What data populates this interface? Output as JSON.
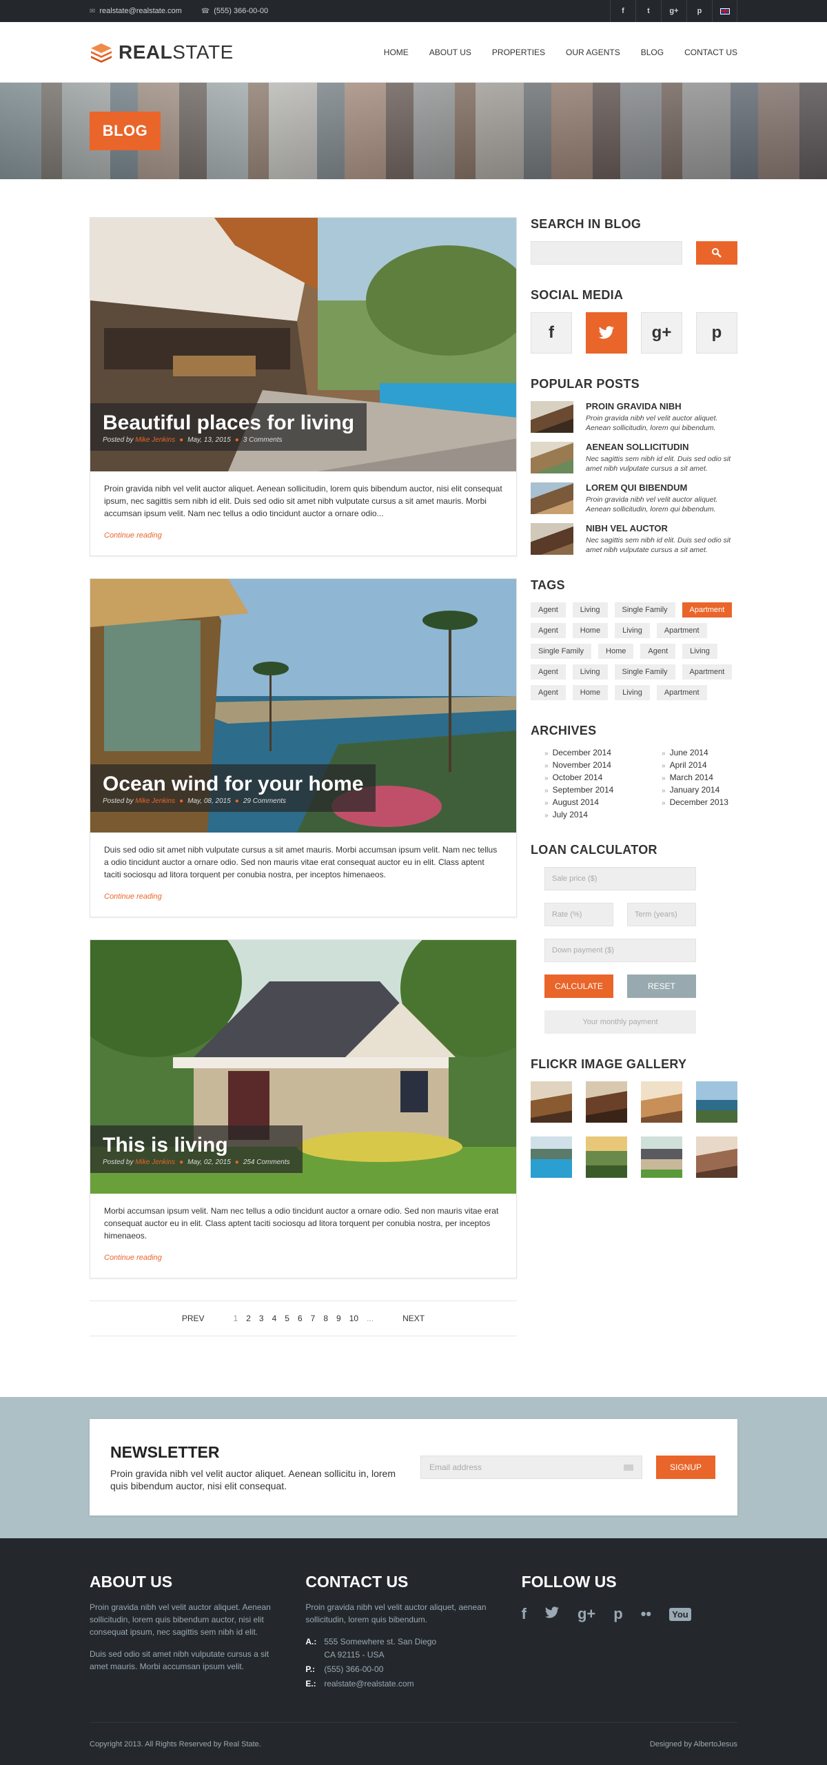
{
  "topbar": {
    "email": "realstate@realstate.com",
    "phone": "(555) 366-00-00",
    "social": [
      "f",
      "t",
      "g+",
      "p"
    ]
  },
  "brand": {
    "bold": "REAL",
    "light": "STATE"
  },
  "nav": [
    "HOME",
    "ABOUT US",
    "PROPERTIES",
    "OUR AGENTS",
    "BLOG",
    "CONTACT US"
  ],
  "hero": {
    "title": "BLOG"
  },
  "posts": [
    {
      "title": "Beautiful places for living",
      "posted_by": "Posted by",
      "author": "Mike Jenkins",
      "date": "May, 13, 2015",
      "comments": "3 Comments",
      "excerpt": "Proin gravida nibh vel velit auctor aliquet. Aenean sollicitudin, lorem quis bibendum auctor, nisi elit consequat ipsum, nec sagittis sem nibh id elit. Duis sed odio sit amet nibh vulputate cursus a sit amet mauris. Morbi accumsan ipsum velit. Nam nec tellus a odio tincidunt auctor a ornare odio...",
      "more": "Continue reading"
    },
    {
      "title": "Ocean wind for your home",
      "posted_by": "Posted by",
      "author": "Mike Jenkins",
      "date": "May, 08, 2015",
      "comments": "29 Comments",
      "excerpt": "Duis sed odio sit amet nibh vulputate cursus a sit amet mauris. Morbi accumsan ipsum velit. Nam nec tellus a odio tincidunt auctor a ornare odio. Sed non  mauris vitae erat consequat auctor eu in elit. Class aptent taciti sociosqu ad litora torquent per conubia nostra, per inceptos himenaeos.",
      "more": "Continue reading"
    },
    {
      "title": "This is living",
      "posted_by": "Posted by",
      "author": "Mike Jenkins",
      "date": "May, 02, 2015",
      "comments": "254 Comments",
      "excerpt": "Morbi accumsan ipsum velit. Nam nec tellus a odio tincidunt auctor a ornare odio. Sed non  mauris vitae erat consequat auctor eu in elit. Class aptent taciti sociosqu ad litora torquent per conubia nostra, per inceptos himenaeos.",
      "more": "Continue reading"
    }
  ],
  "pager": {
    "prev": "PREV",
    "next": "NEXT",
    "pages": [
      "1",
      "2",
      "3",
      "4",
      "5",
      "6",
      "7",
      "8",
      "9",
      "10",
      "..."
    ],
    "current": "1"
  },
  "sidebar": {
    "search_title": "SEARCH IN BLOG",
    "social_title": "SOCIAL MEDIA",
    "social": [
      "f",
      "t",
      "g+",
      "p"
    ],
    "popular_title": "POPULAR POSTS",
    "popular": [
      {
        "title": "PROIN GRAVIDA NIBH",
        "text": "Proin gravida nibh vel velit auctor aliquet. Aenean sollicitudin, lorem qui bibendum."
      },
      {
        "title": "AENEAN SOLLICITUDIN",
        "text": "Nec sagittis sem nibh id elit. Duis sed odio sit amet nibh vulputate cursus a sit amet."
      },
      {
        "title": "LOREM QUI BIBENDUM",
        "text": "Proin gravida nibh vel velit auctor aliquet. Aenean sollicitudin, lorem qui bibendum."
      },
      {
        "title": "NIBH VEL AUCTOR",
        "text": "Nec sagittis sem nibh id elit. Duis sed odio sit amet nibh vulputate cursus a sit amet."
      }
    ],
    "tags_title": "TAGS",
    "tags": [
      [
        "Agent",
        "Living",
        "Single Family",
        "Apartment"
      ],
      [
        "Agent",
        "Home",
        "Living",
        "Apartment"
      ],
      [
        "Single Family",
        "Home",
        "Agent",
        "Living"
      ],
      [
        "Agent",
        "Living",
        "Single Family",
        "Apartment"
      ],
      [
        "Agent",
        "Home",
        "Living",
        "Apartment"
      ]
    ],
    "archives_title": "ARCHIVES",
    "archives": [
      "December 2014",
      "June 2014",
      "November 2014",
      "April 2014",
      "October 2014",
      "March 2014",
      "September 2014",
      "January 2014",
      "August 2014",
      "December 2013",
      "July 2014"
    ],
    "loan_title": "LOAN CALCULATOR",
    "loan": {
      "sale": "Sale price ($)",
      "rate": "Rate (%)",
      "term": "Term (years)",
      "down": "Down payment ($)",
      "calc": "CALCULATE",
      "reset": "RESET",
      "result": "Your monthly payment"
    },
    "gallery_title": "FLICKR IMAGE GALLERY"
  },
  "newsletter": {
    "title": "NEWSLETTER",
    "text": "Proin gravida nibh vel velit auctor aliquet. Aenean sollicitu in, lorem quis bibendum auctor, nisi elit consequat.",
    "placeholder": "Email address",
    "button": "SIGNUP"
  },
  "footer": {
    "about_title": "ABOUT US",
    "about_p1": "Proin gravida nibh vel velit auctor aliquet. Aenean sollicitudin, lorem quis bibendum auctor, nisi elit consequat ipsum, nec sagittis sem nibh id elit.",
    "about_p2": "Duis sed odio sit amet nibh vulputate cursus a sit amet mauris. Morbi accumsan ipsum velit.",
    "contact_title": "CONTACT US",
    "contact_text": "Proin gravida nibh vel velit auctor aliquet, aenean sollicitudin, lorem quis bibendum.",
    "address_label": "A.:",
    "address1": "555 Somewhere st. San Diego",
    "address2": "CA 92115 - USA",
    "phone_label": "P.:",
    "phone": "(555) 366-00-00",
    "email_label": "E.:",
    "email": "realstate@realstate.com",
    "follow_title": "FOLLOW US",
    "follow": [
      "f",
      "t",
      "g+",
      "p",
      "••",
      "You"
    ],
    "copyright": "Copyright 2013. All Rights Reserved by Real State.",
    "designed": "Designed by AlbertoJesus"
  },
  "colors": {
    "accent": "#e9652a",
    "dark": "#24282c",
    "newsletter_bg": "#adc0c6"
  }
}
